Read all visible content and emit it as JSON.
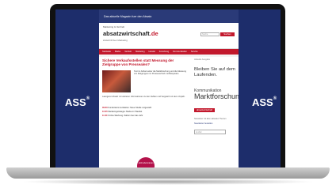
{
  "brand": {
    "side_logo": "ASS",
    "registered": "®"
  },
  "site": {
    "topbar": "Das aktuelle Magazin fuer den Absatz",
    "kicker": "Marketing & Vertrieb",
    "brand_name": "absatzwirtschaft",
    "brand_suffix": ".de",
    "tagline": "Zeitschrift fuer Marketing",
    "search_placeholder": "Suche",
    "search_button": "Suchen",
    "nav": [
      "Startseite",
      "Marke",
      "Vertrieb",
      "Marketing",
      "Handel",
      "Forschung",
      "Kommunikation",
      "Service"
    ],
    "breadcrumb": "Startseite > Artikel"
  },
  "article": {
    "headline": "Sichere Verkaufsstellen statt Messung der Zielgruppe von Pressealen?",
    "body1": "Text im Artikel ueber die Markforschung und die Messung von Zielgruppen im Pressevertrieb mit Beispielen.",
    "body2": "Laengerer Absatz mit weiteren Informationen zu den Zahlen und Vergleich mit dem Vorjahr.",
    "list": [
      {
        "time": "09:30",
        "text": "Kundenkommunikation: Neue Studie vorgestellt"
      },
      {
        "time": "10:05",
        "text": "Marketingstrategie: Marke im Wandel"
      },
      {
        "time": "11:20",
        "text": "Online-Werbung: Zahlen fuer das Jahr"
      }
    ],
    "badge": "Jetzt abonnieren"
  },
  "sidebar": {
    "head": "Aktuelle Ausgabe",
    "bleiben": "Bleiben Sie auf dem Laufenden.",
    "komm": "Kommunikation",
    "markt": "Marktforschung",
    "label": "absatzwirtschaft",
    "info": "Newsletter mit allen aktuellen Themen",
    "link": "Newsletter bestellen",
    "input_placeholder": "E-Mail"
  }
}
